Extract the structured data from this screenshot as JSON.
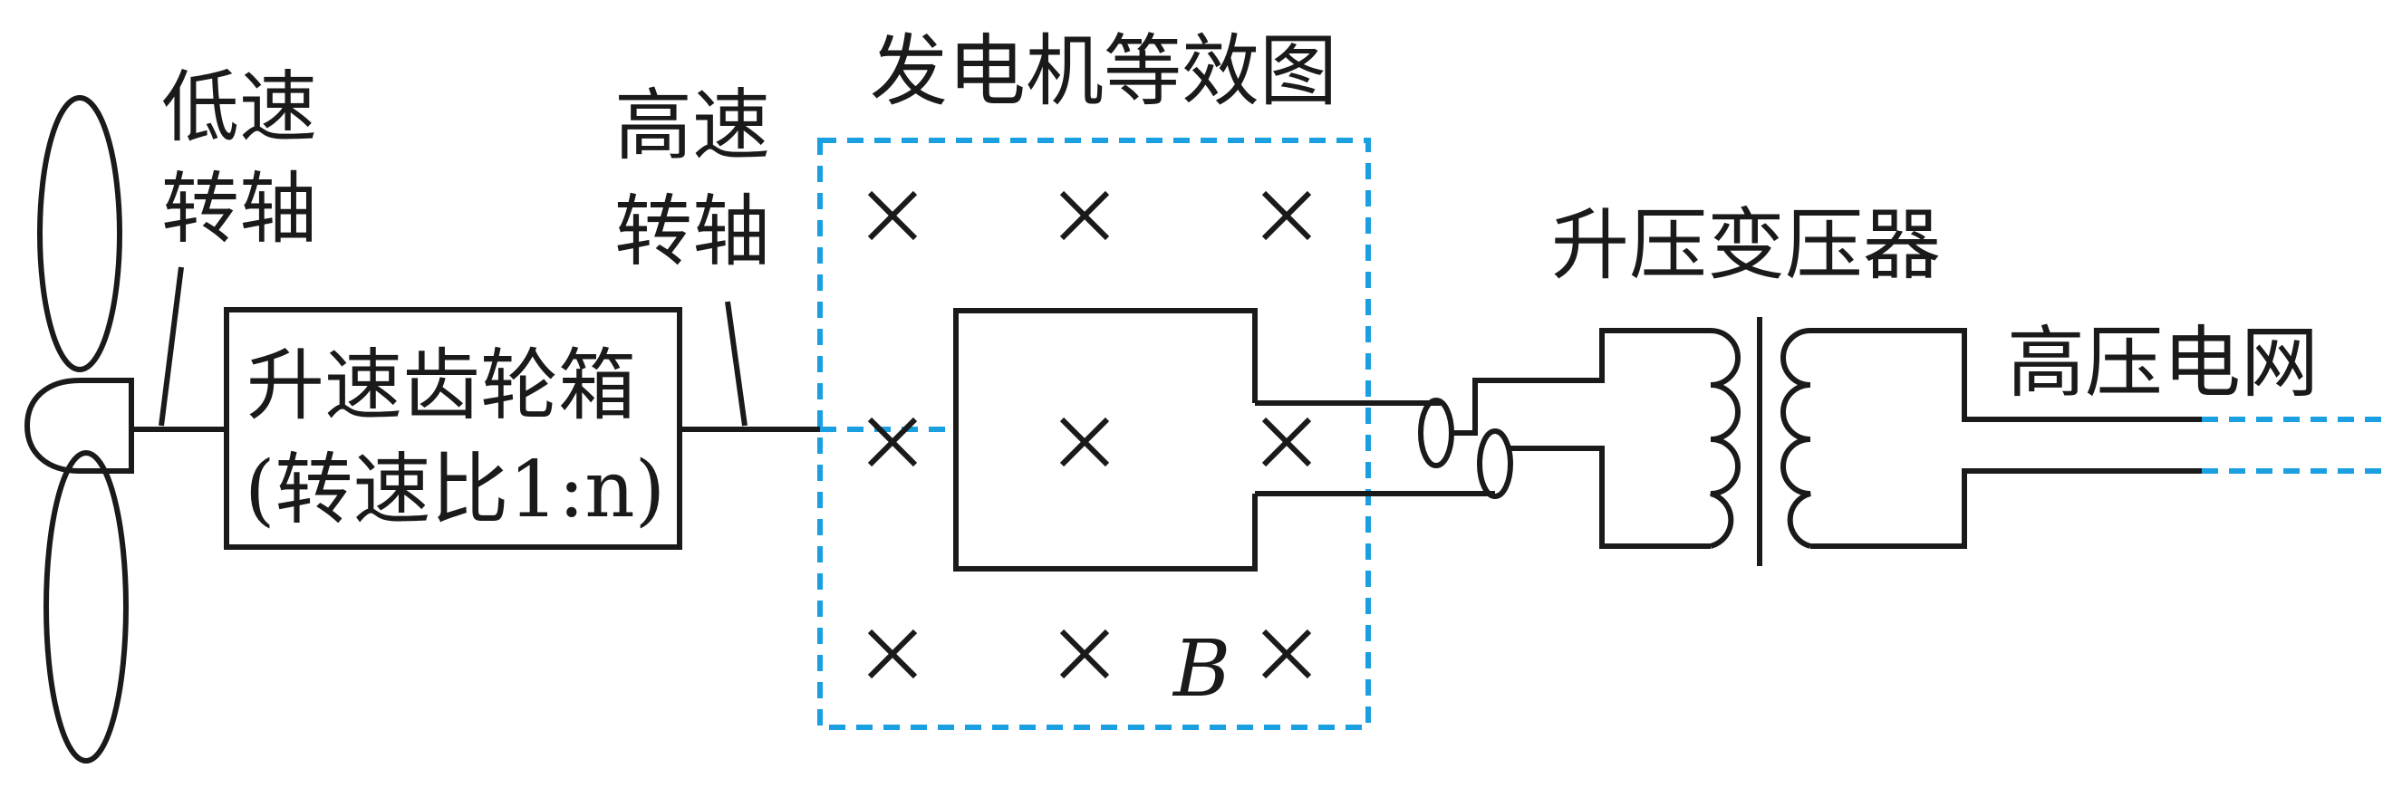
{
  "labels": {
    "low_speed_shaft": [
      "低速",
      "转轴"
    ],
    "high_speed_shaft": [
      "高速",
      "转轴"
    ],
    "generator_equivalent": "发电机等效图",
    "gearbox": "升速齿轮箱",
    "gearbox_ratio": "(转速比1:n)",
    "step_up_transformer": "升压变压器",
    "high_voltage_grid": "高压电网",
    "magnetic_field": "B"
  },
  "colors": {
    "ink": "#1a1a1a",
    "dashed_blue": "#1a9fe0"
  }
}
